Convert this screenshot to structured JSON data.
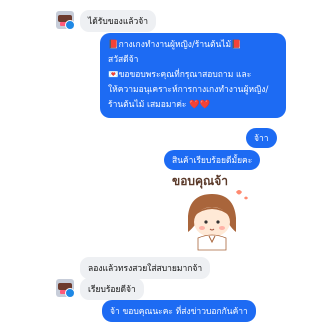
{
  "messages": {
    "m1": "ได้รับของแล้วจ้า",
    "m2": {
      "lines": [
        "📕กางเกงทำงานผู้หญิง/ร้านต้นไม้📕",
        "สวัสดีจ้า",
        "",
        "💌ขอขอบพระคุณที่กรุณาสอบถาม และ",
        "ให้ความอนุเคราะห์การกางเกงทำงานผู้หญิง/",
        "ร้านต้นไม้ เสมอมาค่ะ ❤️❤️"
      ]
    },
    "m3": "จ้าา",
    "m4": "สินค้าเรียบร้อยดีมั้ยคะ",
    "sticker_text": "ขอบคุณจ้า",
    "m5": "ลองแล้วทรงสวยใส่สบายมากจ้า",
    "m6": "เรียบร้อยดีจ้า",
    "m7": "จ้า ขอบคุณนะคะ ที่ส่งข่าวบอกกันค้าา"
  },
  "colors": {
    "outgoing": "#1d6bf3",
    "incoming": "#eef0f3",
    "verified_badge": "#1e88e5"
  }
}
